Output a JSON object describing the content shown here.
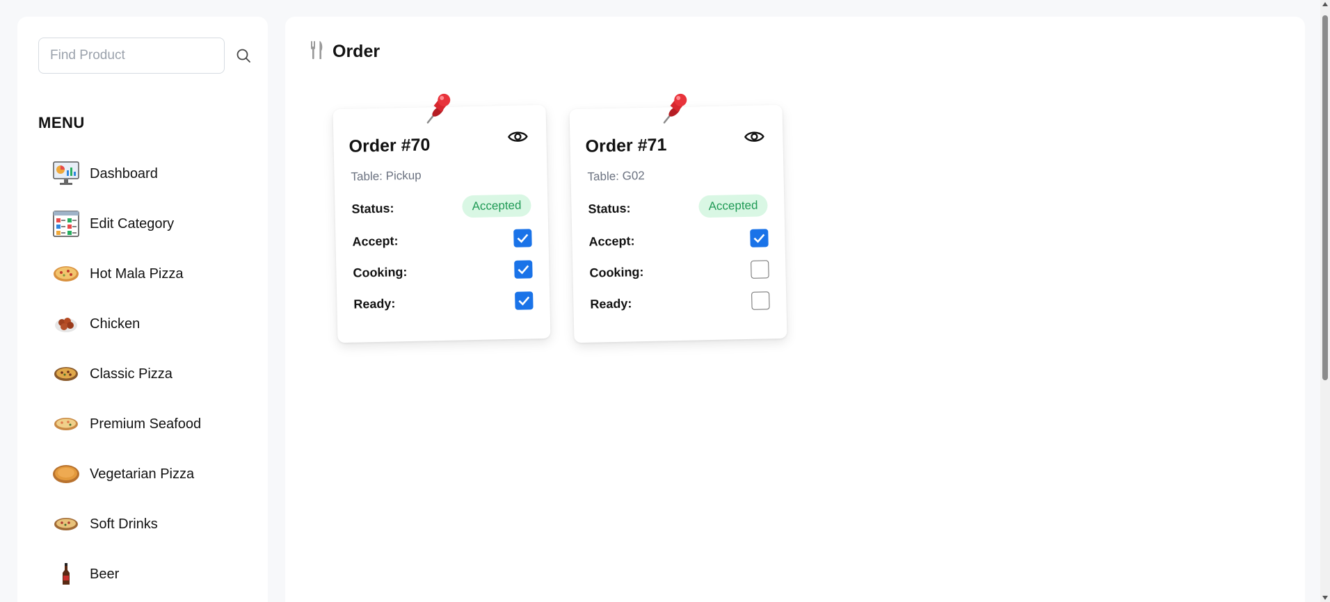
{
  "search": {
    "placeholder": "Find Product",
    "value": ""
  },
  "sidebar": {
    "menu_title": "MENU",
    "items": [
      {
        "label": "Dashboard",
        "icon": "dashboard-icon"
      },
      {
        "label": "Edit Category",
        "icon": "edit-category-icon"
      },
      {
        "label": "Hot Mala Pizza",
        "icon": "pizza-icon"
      },
      {
        "label": "Chicken",
        "icon": "chicken-icon"
      },
      {
        "label": "Classic Pizza",
        "icon": "pizza-icon"
      },
      {
        "label": "Premium Seafood",
        "icon": "pizza-icon"
      },
      {
        "label": "Vegetarian Pizza",
        "icon": "pizza-icon"
      },
      {
        "label": "Soft Drinks",
        "icon": "pizza-icon"
      },
      {
        "label": "Beer",
        "icon": "beer-bottle-icon"
      }
    ]
  },
  "header": {
    "title": "Order",
    "icon": "fork-knife-icon"
  },
  "labels": {
    "status": "Status:",
    "accept": "Accept:",
    "cooking": "Cooking:",
    "ready": "Ready:"
  },
  "orders": [
    {
      "title": "Order #70",
      "table": "Table: Pickup",
      "status": "Accepted",
      "accept": true,
      "cooking": true,
      "ready": true
    },
    {
      "title": "Order #71",
      "table": "Table: G02",
      "status": "Accepted",
      "accept": true,
      "cooking": false,
      "ready": false
    }
  ],
  "colors": {
    "accent": "#1a73e8",
    "status_bg": "#d9f7e4",
    "status_text": "#1f9a55",
    "pin": "#d7262e"
  }
}
